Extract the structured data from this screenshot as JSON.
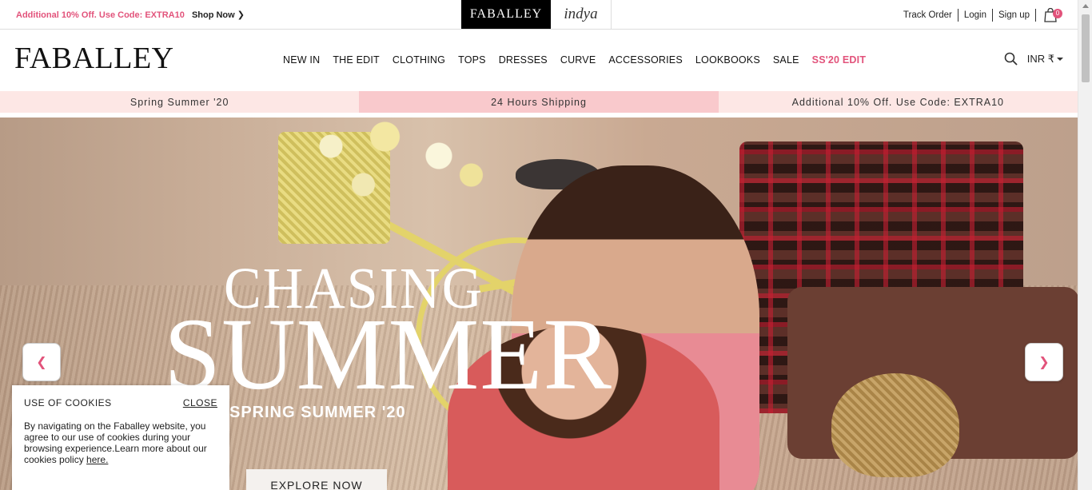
{
  "topbar": {
    "promo_text": "Additional 10% Off. Use Code: EXTRA10",
    "shop_now": "Shop Now",
    "brand_tabs": [
      "FABALLEY",
      "indya"
    ],
    "track_order": "Track Order",
    "login": "Login",
    "signup": "Sign up",
    "cart_count": "0"
  },
  "header": {
    "logo": "FABALLEY",
    "nav": [
      "NEW IN",
      "THE EDIT",
      "CLOTHING",
      "TOPS",
      "DRESSES",
      "CURVE",
      "ACCESSORIES",
      "LOOKBOOKS",
      "SALE",
      "SS'20 EDIT"
    ],
    "currency": "INR ₹"
  },
  "infostrip": [
    "Spring Summer '20",
    "24 Hours Shipping",
    "Additional 10% Off. Use Code: EXTRA10"
  ],
  "hero": {
    "title_line1": "CHASING",
    "title_line2": "SUMMER",
    "subtitle": "SPRING SUMMER '20",
    "cta": "EXPLORE NOW"
  },
  "cookie": {
    "title": "USE OF COOKIES",
    "close": "CLOSE",
    "text": "By navigating on the Faballey website, you agree to our use of cookies during your browsing experience.Learn more about our cookies policy ",
    "link": "here."
  },
  "colors": {
    "accent": "#e2537b",
    "strip_light": "#fde7e5",
    "strip_mid": "#f9c9cc"
  }
}
